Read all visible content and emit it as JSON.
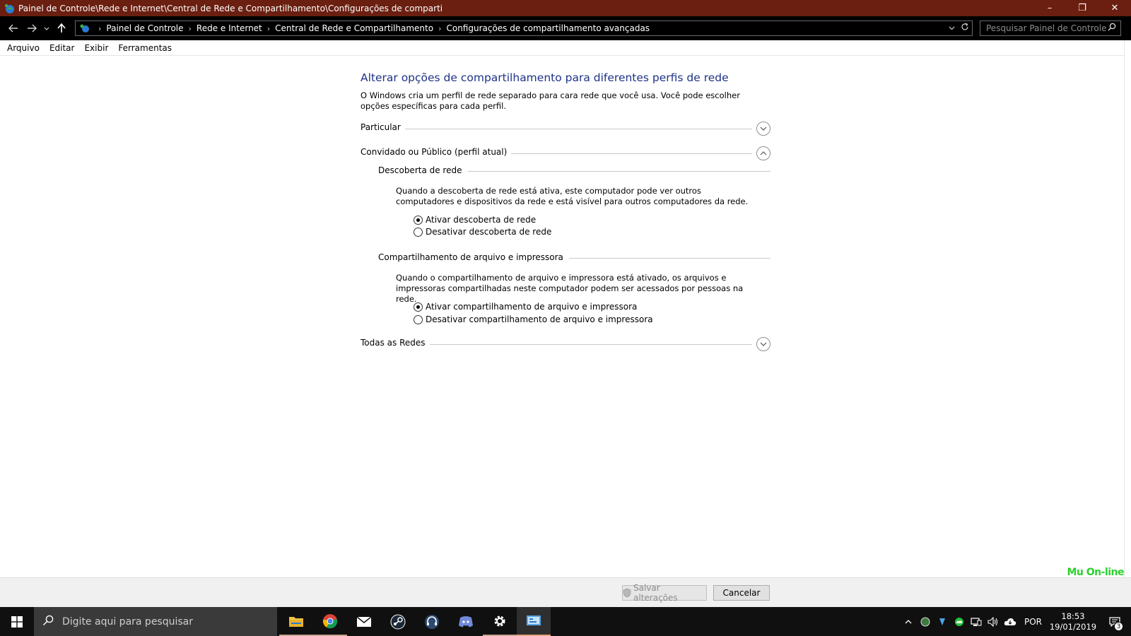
{
  "window": {
    "title": "Painel de Controle\\Rede e Internet\\Central de Rede e Compartilhamento\\Configurações de comparti",
    "minimize_glyph": "–",
    "restore_glyph": "❐",
    "close_glyph": "✕"
  },
  "address": {
    "breadcrumbs": [
      "Painel de Controle",
      "Rede e Internet",
      "Central de Rede e Compartilhamento",
      "Configurações de compartilhamento avançadas"
    ],
    "search_placeholder": "Pesquisar Painel de Controle"
  },
  "menu": [
    "Arquivo",
    "Editar",
    "Exibir",
    "Ferramentas"
  ],
  "main": {
    "heading": "Alterar opções de compartilhamento para diferentes perfis de rede",
    "intro": "O Windows cria um perfil de rede separado para cara rede que você usa. Você pode escolher opções específicas para cada perfil.",
    "profiles": {
      "private": {
        "label": "Particular",
        "state": "collapsed"
      },
      "guest": {
        "label": "Convidado ou Público (perfil atual)",
        "state": "expanded"
      },
      "all": {
        "label": "Todas as Redes",
        "state": "collapsed"
      }
    },
    "discovery": {
      "title": "Descoberta de rede",
      "description": "Quando a descoberta de rede está ativa, este computador pode ver outros computadores e dispositivos da rede e está visível para outros computadores da rede.",
      "option_on": "Ativar descoberta de rede",
      "option_off": "Desativar descoberta de rede",
      "selected": "on"
    },
    "file_sharing": {
      "title": "Compartilhamento de arquivo e impressora",
      "description": "Quando o compartilhamento de arquivo e impressora está ativado, os arquivos e impressoras compartilhadas neste computador podem ser acessados por pessoas na rede.",
      "option_on": "Ativar compartilhamento de arquivo e impressora",
      "option_off": "Desativar compartilhamento de arquivo e impressora",
      "selected": "on"
    }
  },
  "footer": {
    "save_label": "Salvar alterações",
    "save_enabled": false,
    "cancel_label": "Cancelar",
    "watermark": "Mu On-line"
  },
  "taskbar": {
    "search_placeholder": "Digite aqui para pesquisar",
    "apps": [
      "file-explorer-icon",
      "chrome-icon",
      "mail-icon",
      "steam-icon",
      "headset-app-icon",
      "discord-icon",
      "settings-icon",
      "control-panel-icon"
    ],
    "language": "POR",
    "time": "18:53",
    "date": "19/01/2019",
    "notification_count": "3"
  },
  "colors": {
    "titlebar": "#6a1f10",
    "heading": "#1e3287",
    "watermark": "#2cd12c"
  }
}
